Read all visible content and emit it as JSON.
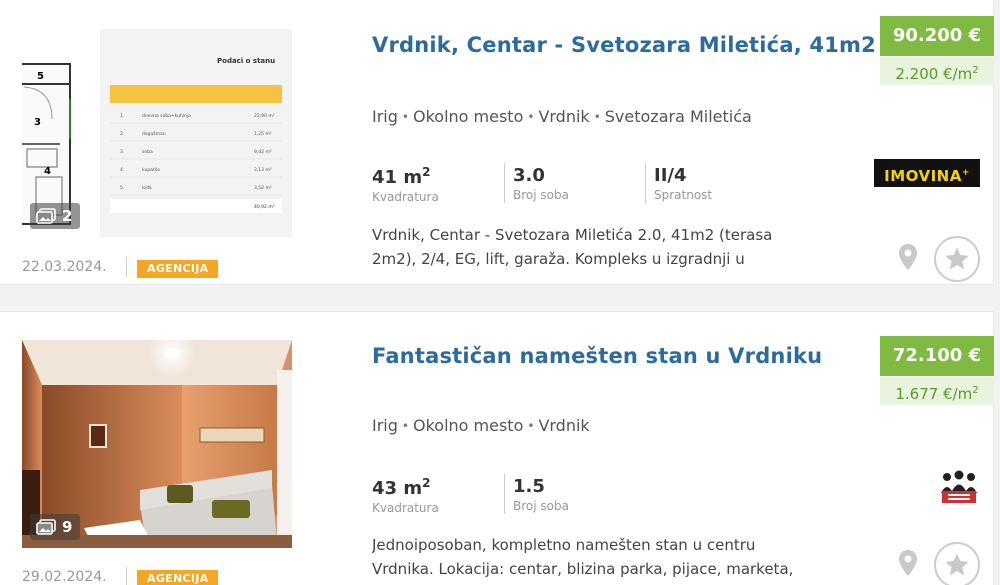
{
  "listings": [
    {
      "title": "Vrdnik, Centar - Svetozara Miletića, 41m2",
      "location": [
        "Irig",
        "Okolno mesto",
        "Vrdnik",
        "Svetozara Miletića"
      ],
      "photo_count": "2",
      "date": "22.03.2024.",
      "badge": "AGENCIJA",
      "area_value": "41 m",
      "area_unit_sup": "2",
      "area_label": "Kvadratura",
      "rooms_value": "3.0",
      "rooms_label": "Broj soba",
      "floor_value": "II/4",
      "floor_label": "Spratnost",
      "description": "Vrdnik, Centar - Svetozara Miletića 2.0, 41m2 (terasa 2m2), 2/4, EG, lift, garaža. Kompleks u izgradnji u",
      "price": "90.200 €",
      "price_per_m2": "2.200 €/m",
      "price_per_m2_sup": "2",
      "agency_logo_text": "IMOVINA",
      "agency_logo_sup": "+",
      "floorplan": {
        "heading": "Podaci o stanu",
        "room_labels": [
          "5",
          "3",
          "4"
        ],
        "rows": [
          {
            "n": "1.",
            "name": "dnevna soba+kuhinja",
            "area": "22,90 m²"
          },
          {
            "n": "2.",
            "name": "degažman",
            "area": "1,25 m²"
          },
          {
            "n": "3.",
            "name": "soba",
            "area": "9,42 m²"
          },
          {
            "n": "4.",
            "name": "kupatilo",
            "area": "3,13 m²"
          },
          {
            "n": "5.",
            "name": "lođa",
            "area": "3,52 m²"
          }
        ],
        "total": "40,92 m²"
      }
    },
    {
      "title": "Fantastičan namešten stan u Vrdniku",
      "location": [
        "Irig",
        "Okolno mesto",
        "Vrdnik"
      ],
      "photo_count": "9",
      "date": "29.02.2024.",
      "badge": "AGENCIJA",
      "area_value": "43 m",
      "area_unit_sup": "2",
      "area_label": "Kvadratura",
      "rooms_value": "1.5",
      "rooms_label": "Broj soba",
      "description": "Jednoiposoban, kompletno namešten stan u centru Vrdnika. Lokacija: centar, blizina parka, pijace, marketa,",
      "price": "72.100 €",
      "price_per_m2": "1.677 €/m",
      "price_per_m2_sup": "2"
    }
  ],
  "colors": {
    "title_blue": "#2c6ba0",
    "price_green": "#7fba42",
    "price_per_m2_bg": "#e9f4dc",
    "badge_orange": "#f5a623"
  },
  "icons": {
    "photo": "image-stack-icon",
    "pin": "map-pin-icon",
    "favorite": "star-icon"
  }
}
